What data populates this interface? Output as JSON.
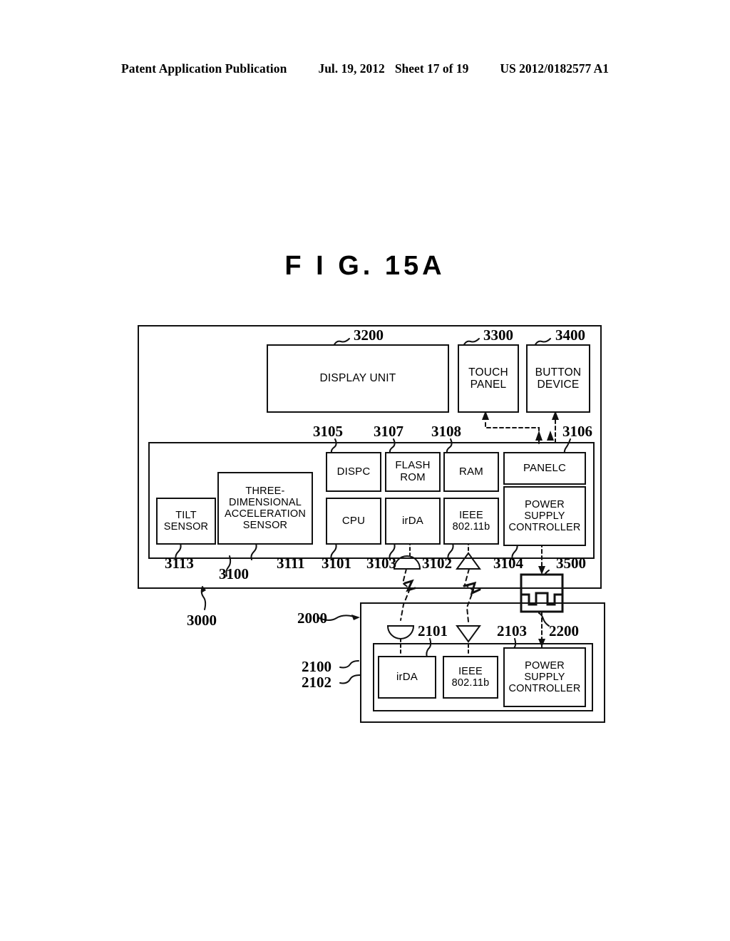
{
  "header": {
    "publication": "Patent Application Publication",
    "date": "Jul. 19, 2012",
    "sheet": "Sheet 17 of 19",
    "number": "US 2012/0182577 A1"
  },
  "figure": {
    "title": "F I G.  15A"
  },
  "diagram": {
    "upper_device": {
      "ref": "3000",
      "inner_unit_ref": "3100",
      "blocks": [
        {
          "id": "display-unit",
          "label": "DISPLAY UNIT",
          "ref": "3200"
        },
        {
          "id": "touch-panel",
          "label": "TOUCH\nPANEL",
          "ref": "3300"
        },
        {
          "id": "button-device",
          "label": "BUTTON\nDEVICE",
          "ref": "3400"
        },
        {
          "id": "dispc",
          "label": "DISPC",
          "ref": "3105"
        },
        {
          "id": "flash-rom",
          "label": "FLASH\nROM",
          "ref": "3107"
        },
        {
          "id": "ram",
          "label": "RAM",
          "ref": "3108"
        },
        {
          "id": "panelc",
          "label": "PANELC",
          "ref": "3106"
        },
        {
          "id": "tilt-sensor",
          "label": "TILT\nSENSOR",
          "ref": "3113"
        },
        {
          "id": "accel-sensor",
          "label": "THREE-\nDIMENSIONAL\nACCELERATION\nSENSOR",
          "ref": "3111"
        },
        {
          "id": "cpu",
          "label": "CPU",
          "ref": "3101"
        },
        {
          "id": "irda",
          "label": "irDA",
          "ref": "3103"
        },
        {
          "id": "ieee",
          "label": "IEEE\n802.11b",
          "ref": "3102"
        },
        {
          "id": "power-supply-controller",
          "label": "POWER\nSUPPLY\nCONTROLLER",
          "ref": "3104"
        }
      ],
      "connector_ref": "3500"
    },
    "lower_device": {
      "ref": "2000",
      "inner_unit_ref": "2100",
      "blocks": [
        {
          "id": "irda-2",
          "label": "irDA",
          "ref": "2102"
        },
        {
          "id": "ieee-2",
          "label": "IEEE\n802.11b",
          "ref": "2101"
        },
        {
          "id": "power-supply-controller-2",
          "label": "POWER\nSUPPLY\nCONTROLLER",
          "ref": "2103"
        }
      ],
      "connector_ref": "2200"
    },
    "icons": {
      "ir_dome_upper": "ir-dome-icon",
      "antenna_upper": "antenna-icon",
      "ir_dome_lower": "ir-dome-icon",
      "antenna_lower": "antenna-icon",
      "connector_upper": "connector-plug-icon"
    }
  },
  "refs": {
    "r3200": "3200",
    "r3300": "3300",
    "r3400": "3400",
    "r3105": "3105",
    "r3107": "3107",
    "r3108": "3108",
    "r3106": "3106",
    "r3113": "3113",
    "r3100": "3100",
    "r3111": "3111",
    "r3101": "3101",
    "r3103": "3103",
    "r3102": "3102",
    "r3104": "3104",
    "r3500": "3500",
    "r3000": "3000",
    "r2000": "2000",
    "r2100": "2100",
    "r2102": "2102",
    "r2101": "2101",
    "r2103": "2103",
    "r2200": "2200"
  },
  "labels": {
    "display_unit": "DISPLAY UNIT",
    "touch_panel_l1": "TOUCH",
    "touch_panel_l2": "PANEL",
    "button_device_l1": "BUTTON",
    "button_device_l2": "DEVICE",
    "dispc": "DISPC",
    "flash_l1": "FLASH",
    "flash_l2": "ROM",
    "ram": "RAM",
    "panelc": "PANELC",
    "tilt_l1": "TILT",
    "tilt_l2": "SENSOR",
    "accel_l1": "THREE-",
    "accel_l2": "DIMENSIONAL",
    "accel_l3": "ACCELERATION",
    "accel_l4": "SENSOR",
    "cpu": "CPU",
    "irda": "irDA",
    "ieee_l1": "IEEE",
    "ieee_l2": "802.11b",
    "psc_l1": "POWER",
    "psc_l2": "SUPPLY",
    "psc_l3": "CONTROLLER",
    "irda2": "irDA",
    "ieee2_l1": "IEEE",
    "ieee2_l2": "802.11b",
    "psc2_l1": "POWER",
    "psc2_l2": "SUPPLY",
    "psc2_l3": "CONTROLLER"
  }
}
